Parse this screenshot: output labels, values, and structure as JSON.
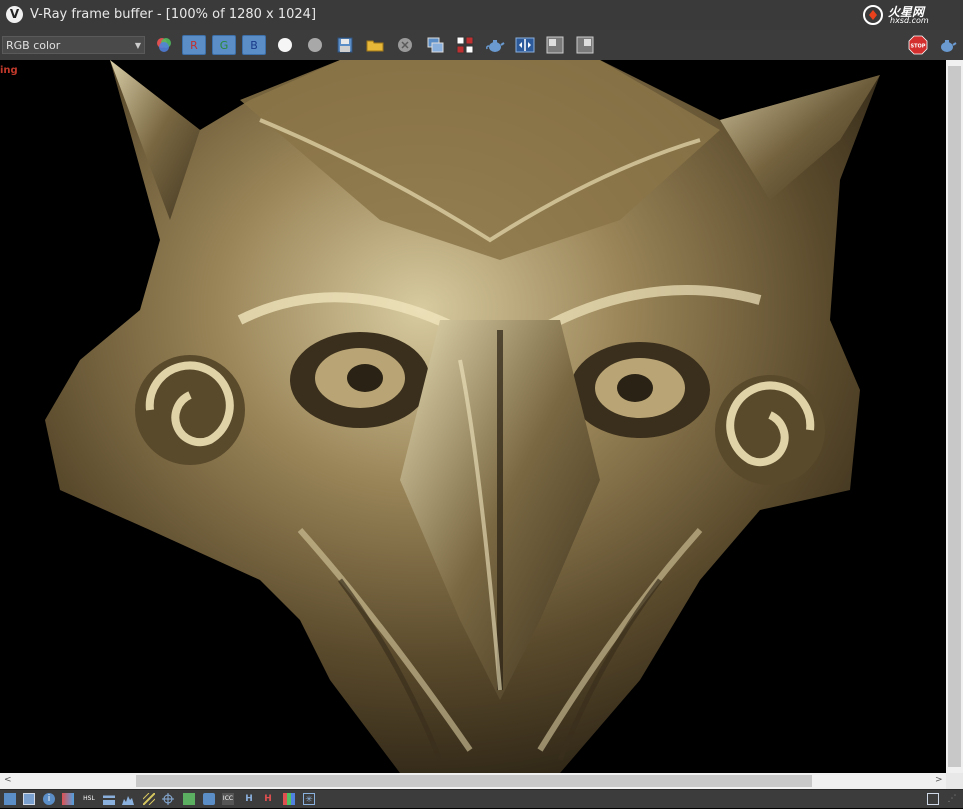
{
  "window": {
    "title": "V-Ray frame buffer - [100% of 1280 x 1024]",
    "app_icon_glyph": "V",
    "watermark_text": "hxsd.com",
    "watermark_brand": "火星网"
  },
  "toolbar": {
    "channel_value": "RGB color",
    "channel_r": "R",
    "channel_g": "G",
    "channel_b": "B",
    "stop_label": "STOP"
  },
  "canvas": {
    "stamp_text": "ing",
    "image_subject": "metallic owl-head relief render"
  },
  "colors": {
    "chrome_bg": "#3c3c3c",
    "channel_button": "#5b8ec7",
    "stamp_red": "#c0392b"
  },
  "status": {
    "icons": [
      "display-icon",
      "frame-icon",
      "info-icon",
      "color-correct-icon",
      "hsl-icon",
      "levels-icon",
      "histogram-icon",
      "exposure-icon",
      "crosshair-icon",
      "lut-icon",
      "ocio-icon",
      "icc-icon",
      "h-icon",
      "compare-icon",
      "overlay-icon",
      "stamp-icon"
    ]
  }
}
